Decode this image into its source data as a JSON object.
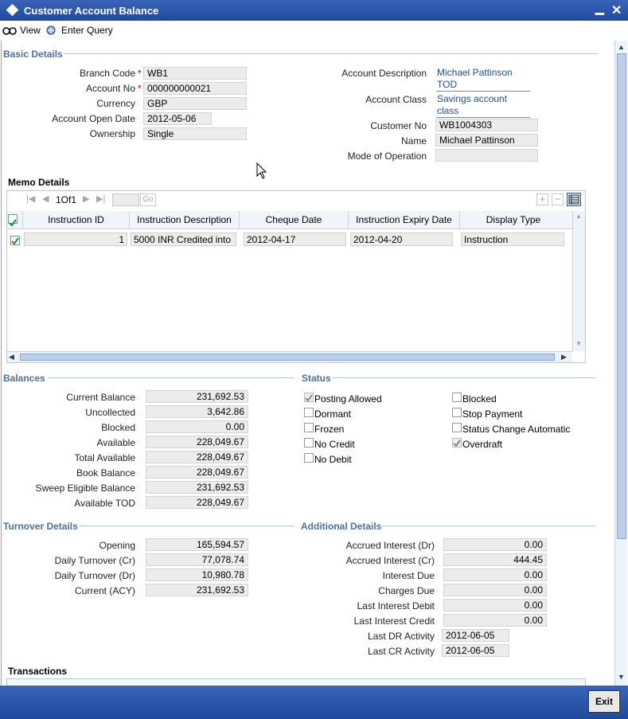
{
  "window": {
    "title": "Customer Account Balance",
    "minimize": "▁",
    "close": "✕"
  },
  "toolbar": {
    "view": "View",
    "enter_query": "Enter Query"
  },
  "basic": {
    "section": "Basic Details",
    "branch_code_label": "Branch Code",
    "branch_code": "WB1",
    "account_no_label": "Account No",
    "account_no": "000000000021",
    "currency_label": "Currency",
    "currency": "GBP",
    "open_date_label": "Account Open Date",
    "open_date": "2012-05-06",
    "ownership_label": "Ownership",
    "ownership": "Single",
    "acc_desc_label": "Account Description",
    "acc_desc_l1": "Michael Pattinson",
    "acc_desc_l2": "TOD",
    "acc_class_label": "Account Class",
    "acc_class_l1": "Savings account",
    "acc_class_l2": "class",
    "customer_no_label": "Customer No",
    "customer_no": "WB1004303",
    "name_label": "Name",
    "name": "Michael Pattinson",
    "mode_label": "Mode of Operation",
    "mode": "",
    "required": "*"
  },
  "memo": {
    "section": "Memo Details",
    "page": "1Of1",
    "go": "Go",
    "headers": [
      "Instruction ID",
      "Instruction Description",
      "Cheque Date",
      "Instruction Expiry Date",
      "Display Type"
    ],
    "row": {
      "id": "1",
      "desc": "5000 INR  Credited into",
      "cheque": "2012-04-17",
      "expiry": "2012-04-20",
      "type": "Instruction"
    }
  },
  "balances": {
    "section": "Balances",
    "rows": [
      {
        "label": "Current Balance",
        "value": "231,692.53"
      },
      {
        "label": "Uncollected",
        "value": "3,642.86"
      },
      {
        "label": "Blocked",
        "value": "0.00"
      },
      {
        "label": "Available",
        "value": "228,049.67"
      },
      {
        "label": "Total Available",
        "value": "228,049.67"
      },
      {
        "label": "Book Balance",
        "value": "228,049.67"
      },
      {
        "label": "Sweep Eligible Balance",
        "value": "231,692.53"
      },
      {
        "label": "Available TOD",
        "value": "228,049.67"
      }
    ]
  },
  "status": {
    "section": "Status",
    "left": [
      {
        "label": "Posting Allowed",
        "checked": true
      },
      {
        "label": "Dormant",
        "checked": false
      },
      {
        "label": "Frozen",
        "checked": false
      },
      {
        "label": "No Credit",
        "checked": false
      },
      {
        "label": "No Debit",
        "checked": false
      }
    ],
    "right": [
      {
        "label": "Blocked",
        "checked": false
      },
      {
        "label": "Stop Payment",
        "checked": false
      },
      {
        "label": "Status Change Automatic",
        "checked": false
      },
      {
        "label": "Overdraft",
        "checked": true
      }
    ]
  },
  "turnover": {
    "section": "Turnover Details",
    "rows": [
      {
        "label": "Opening",
        "value": "165,594.57"
      },
      {
        "label": "Daily Turnover (Cr)",
        "value": "77,078.74"
      },
      {
        "label": "Daily Turnover (Dr)",
        "value": "10,980.78"
      },
      {
        "label": "Current (ACY)",
        "value": "231,692.53"
      }
    ]
  },
  "additional": {
    "section": "Additional Details",
    "rows": [
      {
        "label": "Accrued Interest (Dr)",
        "value": "0.00"
      },
      {
        "label": "Accrued Interest (Cr)",
        "value": "444.45"
      },
      {
        "label": "Interest Due",
        "value": "0.00"
      },
      {
        "label": "Charges Due",
        "value": "0.00"
      },
      {
        "label": "Last Interest Debit",
        "value": "0.00"
      },
      {
        "label": "Last Interest Credit",
        "value": "0.00"
      }
    ],
    "last_dr_label": "Last DR Activity",
    "last_dr": "2012-06-05",
    "last_cr_label": "Last CR Activity",
    "last_cr": "2012-06-05"
  },
  "transactions": {
    "section": "Transactions"
  },
  "footer": {
    "exit": "Exit"
  },
  "colors": {
    "titlebar": "#2a57ad",
    "section": "#4d6fa8",
    "link": "#1f4d9c"
  }
}
